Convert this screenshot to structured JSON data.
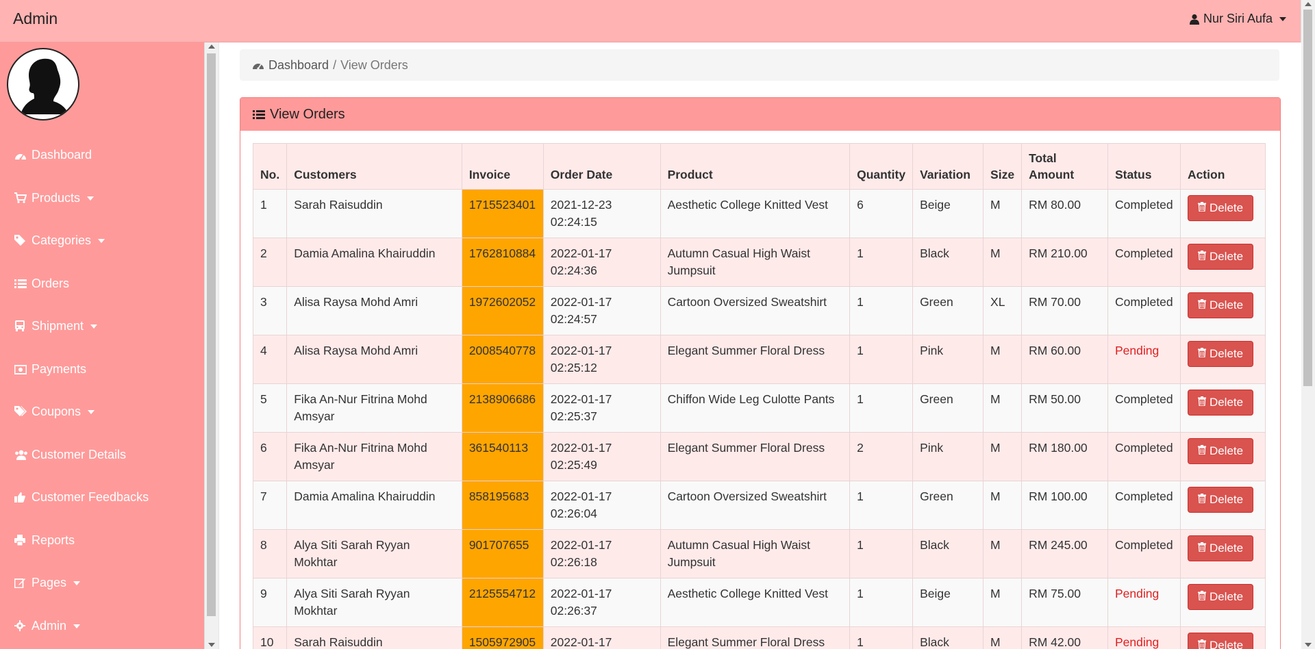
{
  "app": {
    "brand": "Admin",
    "user_name": "Nur Siri Aufa"
  },
  "sidebar": {
    "items": [
      {
        "label": "Dashboard",
        "icon": "dashboard-icon",
        "has_caret": false
      },
      {
        "label": "Products",
        "icon": "cart-icon",
        "has_caret": true
      },
      {
        "label": "Categories",
        "icon": "tag-icon",
        "has_caret": true
      },
      {
        "label": "Orders",
        "icon": "list-icon",
        "has_caret": false
      },
      {
        "label": "Shipment",
        "icon": "bus-icon",
        "has_caret": true
      },
      {
        "label": "Payments",
        "icon": "money-icon",
        "has_caret": false
      },
      {
        "label": "Coupons",
        "icon": "tags-icon",
        "has_caret": true
      },
      {
        "label": "Customer Details",
        "icon": "users-icon",
        "has_caret": false
      },
      {
        "label": "Customer Feedbacks",
        "icon": "thumbs-up-icon",
        "has_caret": false
      },
      {
        "label": "Reports",
        "icon": "print-icon",
        "has_caret": false
      },
      {
        "label": "Pages",
        "icon": "edit-icon",
        "has_caret": true
      },
      {
        "label": "Admin",
        "icon": "gear-icon",
        "has_caret": true
      }
    ]
  },
  "breadcrumb": {
    "home": "Dashboard",
    "separator": "/",
    "current": "View Orders"
  },
  "panel": {
    "title": "View Orders"
  },
  "table": {
    "headers": {
      "no": "No.",
      "customers": "Customers",
      "invoice": "Invoice",
      "order_date": "Order Date",
      "product": "Product",
      "quantity": "Quantity",
      "variation": "Variation",
      "size": "Size",
      "total_amount": "Total Amount",
      "status": "Status",
      "action": "Action"
    },
    "delete_label": "Delete",
    "rows": [
      {
        "no": "1",
        "customer": "Sarah Raisuddin",
        "invoice": "1715523401",
        "date": "2021-12-23",
        "time": "02:24:15",
        "product": "Aesthetic College Knitted Vest",
        "quantity": "6",
        "variation": "Beige",
        "size": "M",
        "total": "RM 80.00",
        "status": "Completed"
      },
      {
        "no": "2",
        "customer": "Damia Amalina Khairuddin",
        "invoice": "1762810884",
        "date": "2022-01-17",
        "time": "02:24:36",
        "product": "Autumn Casual High Waist Jumpsuit",
        "quantity": "1",
        "variation": "Black",
        "size": "M",
        "total": "RM 210.00",
        "status": "Completed"
      },
      {
        "no": "3",
        "customer": "Alisa Raysa Mohd Amri",
        "invoice": "1972602052",
        "date": "2022-01-17",
        "time": "02:24:57",
        "product": "Cartoon Oversized Sweatshirt",
        "quantity": "1",
        "variation": "Green",
        "size": "XL",
        "total": "RM 70.00",
        "status": "Completed"
      },
      {
        "no": "4",
        "customer": "Alisa Raysa Mohd Amri",
        "invoice": "2008540778",
        "date": "2022-01-17",
        "time": "02:25:12",
        "product": "Elegant Summer Floral Dress",
        "quantity": "1",
        "variation": "Pink",
        "size": "M",
        "total": "RM 60.00",
        "status": "Pending"
      },
      {
        "no": "5",
        "customer": "Fika An-Nur Fitrina Mohd Amsyar",
        "invoice": "2138906686",
        "date": "2022-01-17",
        "time": "02:25:37",
        "product": "Chiffon Wide Leg Culotte Pants",
        "quantity": "1",
        "variation": "Green",
        "size": "M",
        "total": "RM 50.00",
        "status": "Completed"
      },
      {
        "no": "6",
        "customer": "Fika An-Nur Fitrina Mohd Amsyar",
        "invoice": "361540113",
        "date": "2022-01-17",
        "time": "02:25:49",
        "product": "Elegant Summer Floral Dress",
        "quantity": "2",
        "variation": "Pink",
        "size": "M",
        "total": "RM 180.00",
        "status": "Completed"
      },
      {
        "no": "7",
        "customer": "Damia Amalina Khairuddin",
        "invoice": "858195683",
        "date": "2022-01-17",
        "time": "02:26:04",
        "product": "Cartoon Oversized Sweatshirt",
        "quantity": "1",
        "variation": "Green",
        "size": "M",
        "total": "RM 100.00",
        "status": "Completed"
      },
      {
        "no": "8",
        "customer": "Alya Siti Sarah Ryyan Mokhtar",
        "invoice": "901707655",
        "date": "2022-01-17",
        "time": "02:26:18",
        "product": "Autumn Casual High Waist Jumpsuit",
        "quantity": "1",
        "variation": "Black",
        "size": "M",
        "total": "RM 245.00",
        "status": "Completed"
      },
      {
        "no": "9",
        "customer": "Alya Siti Sarah Ryyan Mokhtar",
        "invoice": "2125554712",
        "date": "2022-01-17",
        "time": "02:26:37",
        "product": "Aesthetic College Knitted Vest",
        "quantity": "1",
        "variation": "Beige",
        "size": "M",
        "total": "RM 75.00",
        "status": "Pending"
      },
      {
        "no": "10",
        "customer": "Sarah Raisuddin",
        "invoice": "1505972905",
        "date": "2022-01-17",
        "time": "",
        "product": "Elegant Summer Floral Dress",
        "quantity": "1",
        "variation": "Black",
        "size": "M",
        "total": "RM 42.00",
        "status": "Pending"
      }
    ]
  },
  "colors": {
    "topbar": "#ffb3b3",
    "sidebar": "#ff9a9a",
    "panel_heading": "#ff9a9a",
    "invoice_cell": "#ffa500",
    "pending_text": "#e02020",
    "delete_button": "#d9534f"
  }
}
